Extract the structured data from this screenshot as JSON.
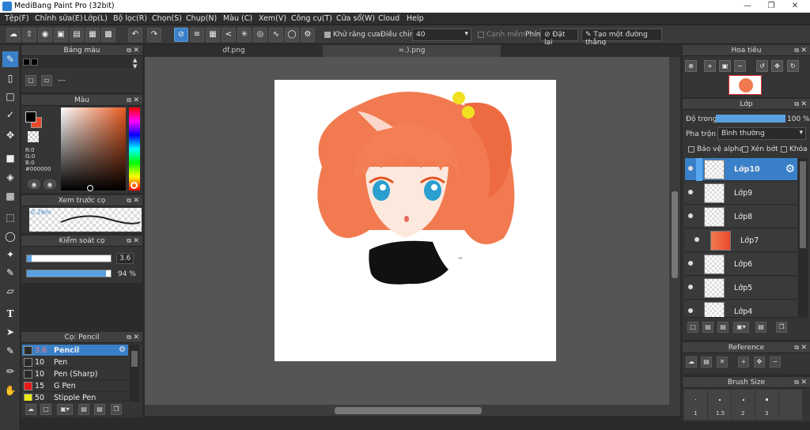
{
  "window": {
    "title": "MediBang Paint Pro (32bit)"
  },
  "menu": [
    "Tệp(F)",
    "Chỉnh sửa(E)",
    "Lớp(L)",
    "Bộ lọc(R)",
    "Chọn(S)",
    "Chụp(N)",
    "Màu (C)",
    "Xem(V)",
    "Công cụ(T)",
    "Cửa sổ(W)",
    "Cloud",
    "Help"
  ],
  "toolbar": {
    "antialias_label": "Khử răng cưa",
    "correction_label": "Điều chỉnh",
    "correction_value": "40",
    "edge_label": "Cạnh mềm",
    "key_label": "Phím",
    "reset_label": "Đặt lại",
    "create_line_label": "Tạo một đường thẳng"
  },
  "palette": {
    "title": "Bảng màu",
    "item": "---"
  },
  "color": {
    "title": "Màu",
    "r": "R:0",
    "g": "G:0",
    "b": "B:0",
    "hex": "#000000",
    "fg": "#000000",
    "bg": "#e84a2a"
  },
  "preview": {
    "title": "Xem trước cọ",
    "size": "0.26m"
  },
  "brush_control": {
    "title": "Kiểm soát cọ",
    "size_value": "3.6",
    "opacity_value": "94 %",
    "size_frac": 1.0,
    "opacity_frac": 0.94
  },
  "brushes": {
    "title": "Cọ: Pencil",
    "items": [
      {
        "size": "3.6",
        "name": "Pencil",
        "color": "#2a2a2a"
      },
      {
        "size": "10",
        "name": "Pen",
        "color": "#2a2a2a"
      },
      {
        "size": "10",
        "name": "Pen (Sharp)",
        "color": "#2a2a2a"
      },
      {
        "size": "15",
        "name": "G Pen",
        "color": "#e81a1a"
      },
      {
        "size": "50",
        "name": "Stipple Pen",
        "color": "#e8e81a"
      }
    ]
  },
  "tabs": [
    "df.png",
    "=.).png"
  ],
  "navigator": {
    "title": "Hoa tiêu"
  },
  "layers": {
    "title": "Lớp",
    "opacity_label": "Độ trong",
    "opacity_value": "100 %",
    "opacity_frac": 1.0,
    "blend_label": "Pha trộn",
    "blend_value": "Bình thường",
    "protect_alpha": "Bảo vệ alpha",
    "clipping": "Xén bớt",
    "lock": "Khóa",
    "items": [
      "Lớp10",
      "Lớp9",
      "Lớp8",
      "Lớp7",
      "Lớp6",
      "Lớp5",
      "Lớp4"
    ]
  },
  "reference": {
    "title": "Reference"
  },
  "brush_size": {
    "title": "Brush Size",
    "sizes": [
      "1",
      "1.5",
      "2",
      "3"
    ]
  }
}
